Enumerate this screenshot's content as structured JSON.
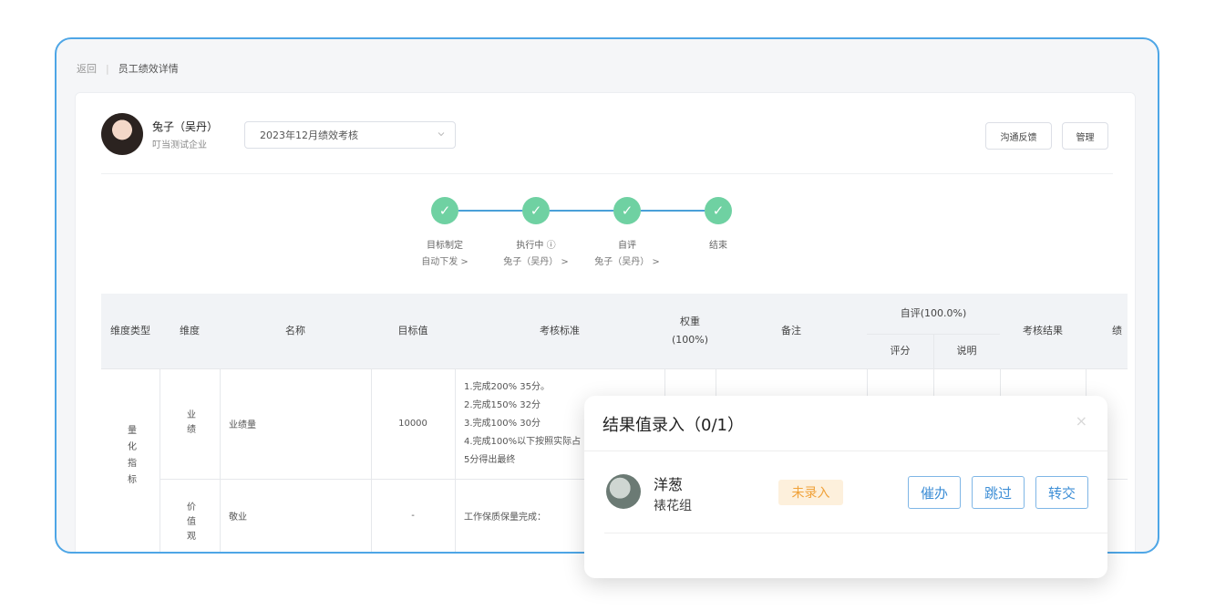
{
  "breadcrumb": {
    "back": "返回",
    "title": "员工绩效详情"
  },
  "profile": {
    "name": "兔子（吴丹）",
    "company": "叮当测试企业"
  },
  "period_select": {
    "value": "2023年12月绩效考核"
  },
  "actions": {
    "feedback": "沟通反馈",
    "manage": "管理"
  },
  "steps": [
    {
      "label": "目标制定",
      "sub": "自动下发 >"
    },
    {
      "label": "执行中 ⓘ",
      "sub": "兔子（吴丹） >"
    },
    {
      "label": "自评",
      "sub": "兔子（吴丹） >"
    },
    {
      "label": "结束",
      "sub": ""
    }
  ],
  "table": {
    "headers": {
      "dim_type": "维度类型",
      "dim": "维度",
      "name": "名称",
      "target": "目标值",
      "criteria": "考核标准",
      "weight": "权重(100%)",
      "remark": "备注",
      "self_eval": "自评(100.0%)",
      "score": "评分",
      "explain": "说明",
      "result": "考核结果",
      "more": "绩"
    },
    "group_label": "量化指标",
    "rows": [
      {
        "dim": "业绩",
        "name": "业绩量",
        "target": "10000",
        "criteria": [
          "1.完成200% 35分。",
          "2.完成150% 32分",
          "3.完成100% 30分",
          "4.完成100%以下按照实际占",
          "5分得出最终"
        ]
      },
      {
        "dim": "价值观",
        "name": "敬业",
        "target": "-",
        "criteria": [
          "工作保质保量完成："
        ]
      }
    ]
  },
  "modal": {
    "title": "结果值录入（0/1）",
    "close": "×",
    "user": {
      "name": "洋葱",
      "group": "裱花组",
      "status": "未录入"
    },
    "buttons": {
      "remind": "催办",
      "skip": "跳过",
      "transfer": "转交"
    }
  },
  "colors": {
    "accent": "#4ea6e6",
    "step_done": "#6fd1a2",
    "pending": "#f0a23a"
  }
}
